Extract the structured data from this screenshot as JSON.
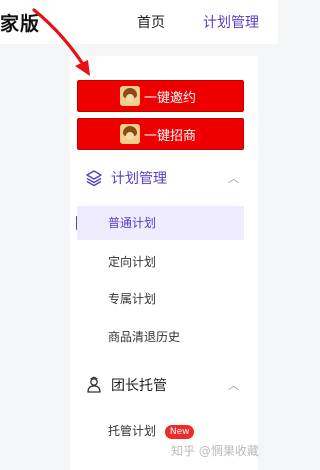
{
  "header": {
    "brand": "家版",
    "nav": [
      "首页",
      "计划管理"
    ]
  },
  "actions": [
    {
      "label": "一键邀约",
      "icon": "avatar-icon"
    },
    {
      "label": "一键招商",
      "icon": "avatar-icon"
    }
  ],
  "sidebar": {
    "groups": [
      {
        "label": "计划管理",
        "icon": "layers-icon",
        "expanded": true,
        "items": [
          {
            "label": "普通计划",
            "active": true
          },
          {
            "label": "定向计划"
          },
          {
            "label": "专属计划"
          },
          {
            "label": "商品清退历史"
          }
        ]
      },
      {
        "label": "团长托管",
        "icon": "leader-icon",
        "expanded": true,
        "items": [
          {
            "label": "托管计划",
            "badge": "New"
          }
        ]
      }
    ]
  },
  "watermark": "知乎 @惘果收藏",
  "colors": {
    "accent": "#5b3cc4",
    "cta": "#ee0000",
    "active_bg": "#f0ecff",
    "badge": "#ee2a2a",
    "arrow": "#e81010"
  }
}
